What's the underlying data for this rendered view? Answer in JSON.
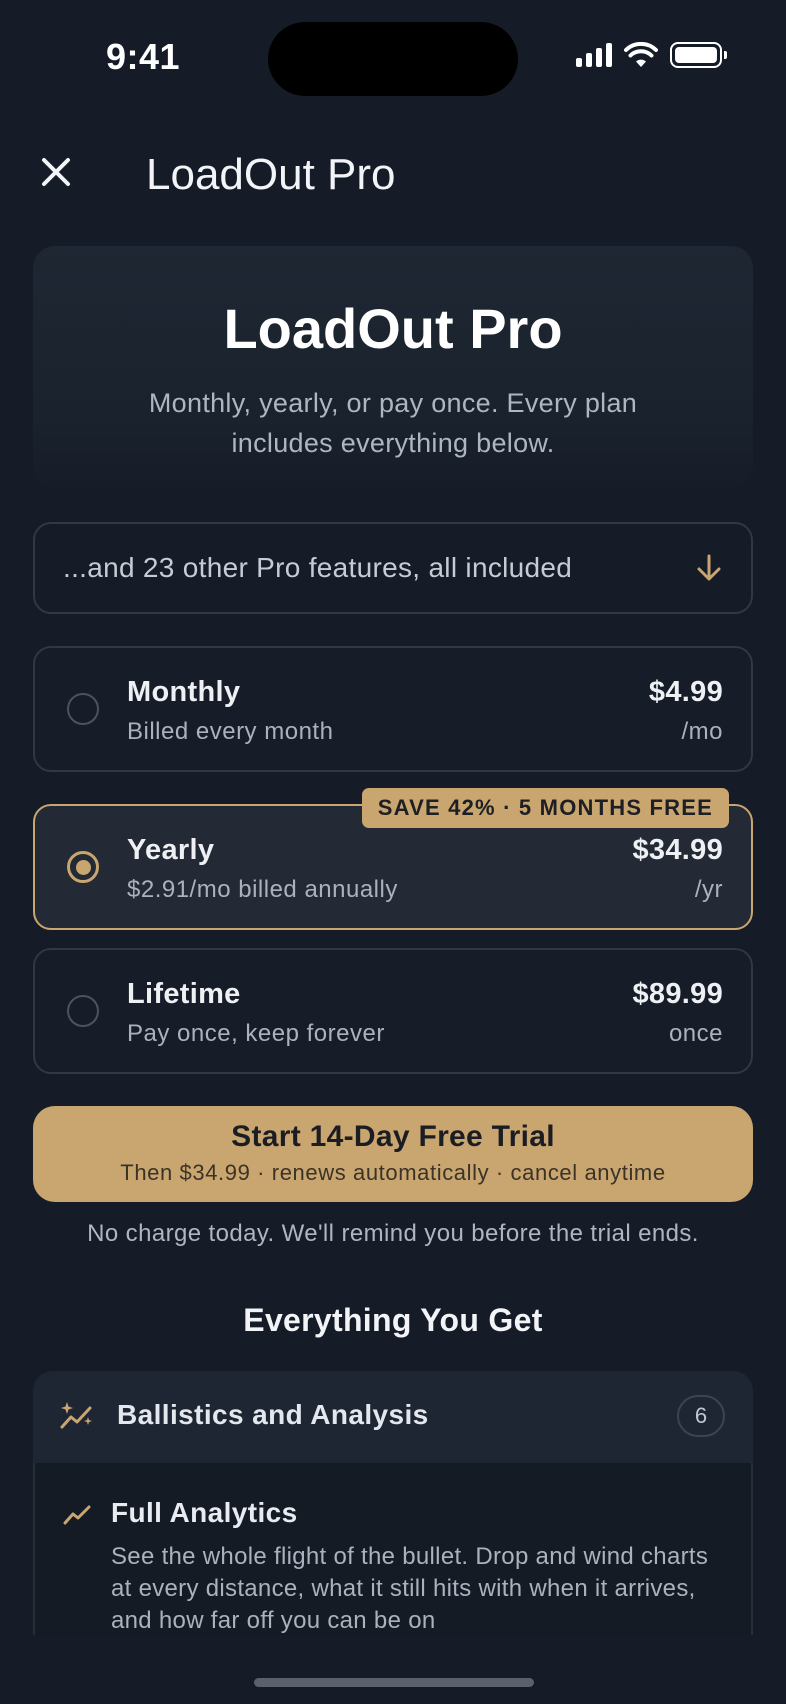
{
  "status_bar": {
    "time": "9:41"
  },
  "nav": {
    "title": "LoadOut Pro"
  },
  "hero": {
    "title": "LoadOut Pro",
    "subtitle": "Monthly, yearly, or pay once. Every plan includes everything below."
  },
  "more_features": {
    "label": "...and 23 other Pro features, all included"
  },
  "plans": [
    {
      "name": "Monthly",
      "description": "Billed every month",
      "price": "$4.99",
      "period": "/mo",
      "selected": false
    },
    {
      "name": "Yearly",
      "description": "$2.91/mo billed annually",
      "price": "$34.99",
      "period": "/yr",
      "selected": true,
      "badge": "SAVE 42% · 5 MONTHS FREE"
    },
    {
      "name": "Lifetime",
      "description": "Pay once, keep forever",
      "price": "$89.99",
      "period": "once",
      "selected": false
    }
  ],
  "cta": {
    "title": "Start 14-Day Free Trial",
    "subtitle": "Then $34.99 · renews automatically · cancel anytime"
  },
  "no_charge_note": "No charge today. We'll remind you before the trial ends.",
  "section_title": "Everything You Get",
  "feature_group": {
    "icon": "sparkle-chart-icon",
    "label": "Ballistics and Analysis",
    "count": "6",
    "items": [
      {
        "icon": "trend-line-icon",
        "title": "Full Analytics",
        "description": "See the whole flight of the bullet. Drop and wind charts at every distance, what it still hits with when it arrives, and how far off you can be on"
      }
    ]
  },
  "colors": {
    "background": "#151c27",
    "accent": "#c9a570",
    "card_border": "#2e3846"
  }
}
